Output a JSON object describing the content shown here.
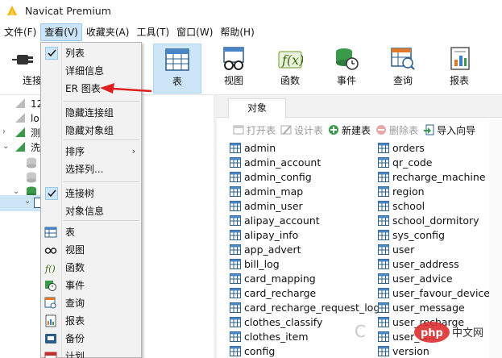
{
  "window": {
    "title": "Navicat Premium"
  },
  "menubar": [
    {
      "label": "文件(F)"
    },
    {
      "label": "查看(V)"
    },
    {
      "label": "收藏夹(A)"
    },
    {
      "label": "工具(T)"
    },
    {
      "label": "窗口(W)"
    },
    {
      "label": "帮助(H)"
    }
  ],
  "toolbar": {
    "connect_label": "连接",
    "buttons": [
      {
        "label": "表",
        "icon": "table-icon",
        "selected": true
      },
      {
        "label": "视图",
        "icon": "view-icon"
      },
      {
        "label": "函数",
        "icon": "function-icon"
      },
      {
        "label": "事件",
        "icon": "event-icon"
      },
      {
        "label": "查询",
        "icon": "query-icon"
      },
      {
        "label": "报表",
        "icon": "report-icon"
      }
    ]
  },
  "tree": {
    "items": [
      {
        "text": "12"
      },
      {
        "text": "lo"
      },
      {
        "text": "测"
      },
      {
        "text": "洗"
      }
    ]
  },
  "view_menu": {
    "items": [
      {
        "label": "列表",
        "checked": true
      },
      {
        "label": "详细信息"
      },
      {
        "label": "ER 图表"
      },
      {
        "label": "隐藏连接组"
      },
      {
        "label": "隐藏对象组"
      },
      {
        "label": "排序",
        "submenu": "›"
      },
      {
        "label": "选择列..."
      },
      {
        "label": "连接树",
        "checked": true
      },
      {
        "label": "对象信息"
      },
      {
        "label": "表",
        "icon": "table-icon"
      },
      {
        "label": "视图",
        "icon": "view-icon"
      },
      {
        "label": "函数",
        "icon": "function-icon"
      },
      {
        "label": "事件",
        "icon": "event-icon"
      },
      {
        "label": "查询",
        "icon": "query-icon"
      },
      {
        "label": "报表",
        "icon": "report-icon"
      },
      {
        "label": "备份",
        "icon": "backup-icon"
      },
      {
        "label": "计划",
        "icon": "schedule-icon"
      }
    ]
  },
  "objects": {
    "tab_label": "对象",
    "toolbar": [
      {
        "label": "打开表",
        "enabled": false
      },
      {
        "label": "设计表",
        "enabled": false
      },
      {
        "label": "新建表",
        "enabled": true
      },
      {
        "label": "删除表",
        "enabled": false
      },
      {
        "label": "导入向导",
        "enabled": true
      }
    ],
    "tables_col1": [
      "admin",
      "admin_account",
      "admin_config",
      "admin_map",
      "admin_user",
      "alipay_account",
      "alipay_info",
      "app_advert",
      "bill_log",
      "card_mapping",
      "card_recharge",
      "card_recharge_request_log",
      "clothes_classify",
      "clothes_item",
      "config"
    ],
    "tables_col2": [
      "orders",
      "qr_code",
      "recharge_machine",
      "region",
      "school",
      "school_dormitory",
      "sys_config",
      "user",
      "user_address",
      "user_advice",
      "user_favour_devices",
      "user_message",
      "user_recharge",
      "user_sms",
      "version"
    ]
  },
  "watermark": {
    "text": "php中文网"
  },
  "colors": {
    "accent": "#0078d7",
    "selection": "#cde6f7",
    "arrow": "#e02020"
  }
}
